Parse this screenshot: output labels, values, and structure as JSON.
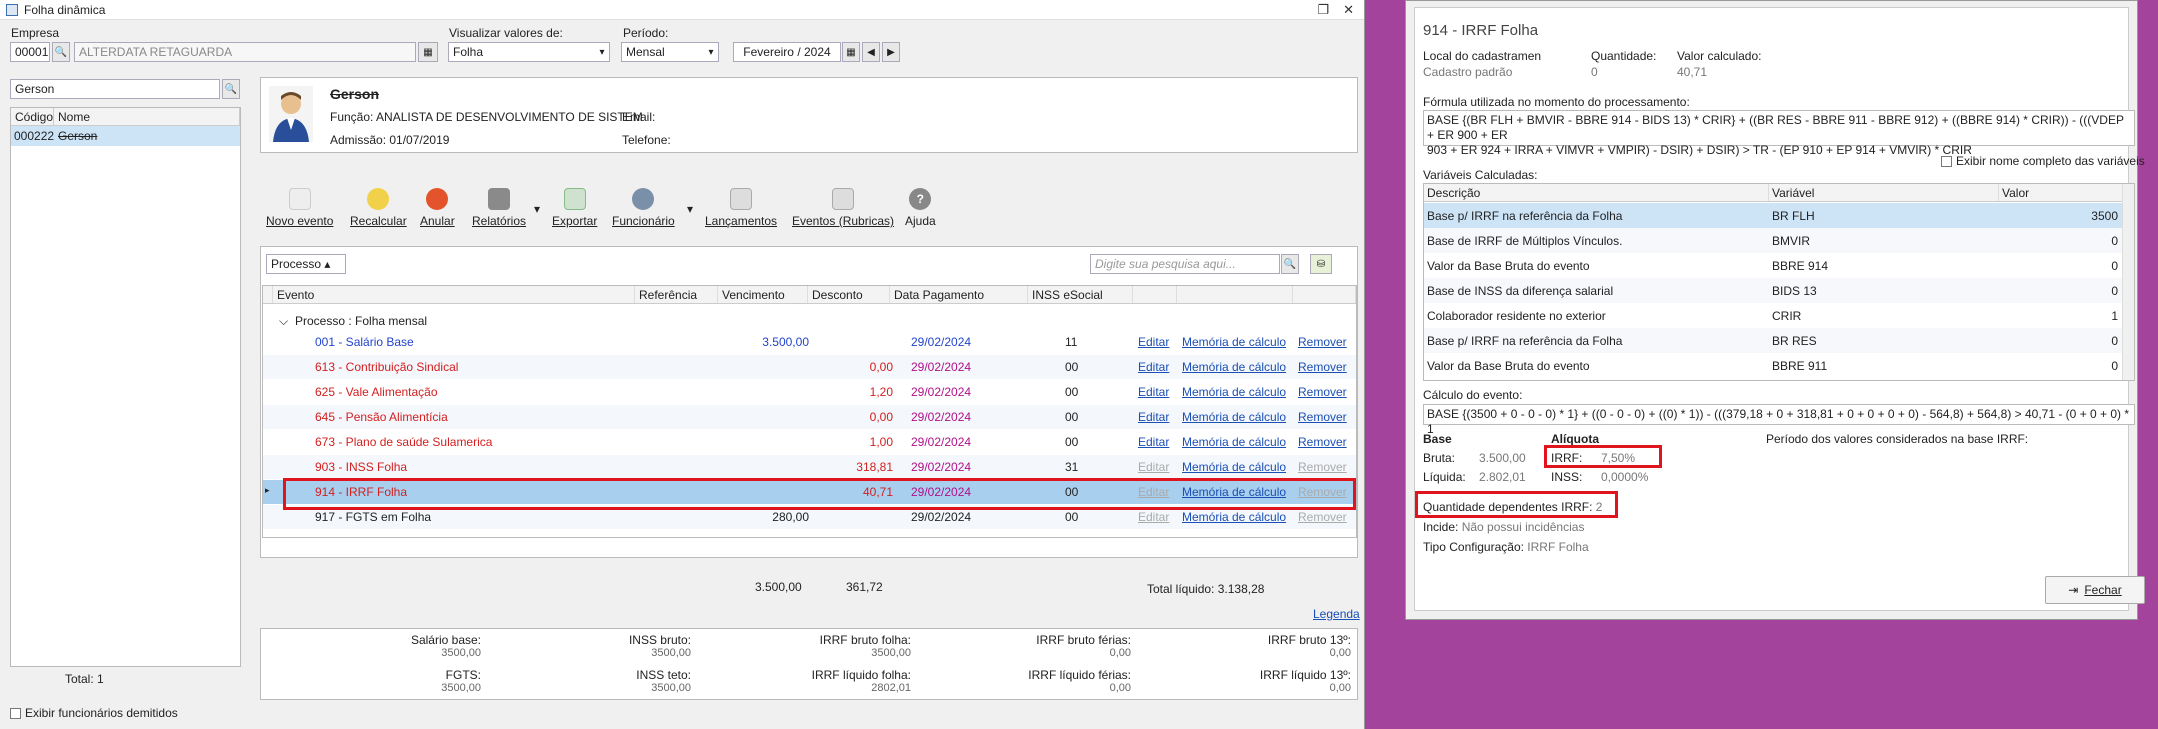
{
  "window": {
    "title": "Folha dinâmica"
  },
  "filters": {
    "empresa_label": "Empresa",
    "empresa_code": "00001",
    "empresa_name": "ALTERDATA RETAGUARDA",
    "visualizar_label": "Visualizar valores de:",
    "visualizar_value": "Folha",
    "periodo_label": "Período:",
    "periodo_value": "Mensal",
    "periodo_date": "Fevereiro / 2024"
  },
  "employee_search": {
    "value": "Gerson"
  },
  "employee_list": {
    "headers": [
      "Código",
      "Nome"
    ],
    "rows": [
      {
        "code": "000222",
        "name": "Gerson"
      }
    ],
    "total": "Total: 1",
    "show_dismissed": "Exibir funcionários demitidos"
  },
  "employee": {
    "name": "Gerson",
    "funcao": "Função: ANALISTA DE DESENVOLVIMENTO DE SISTEM",
    "admissao": "Admissão: 01/07/2019",
    "email": "Email:",
    "telefone": "Telefone:"
  },
  "toolbar": {
    "novo_evento": "Novo evento",
    "recalcular": "Recalcular",
    "anular": "Anular",
    "relatorios": "Relatórios",
    "exportar": "Exportar",
    "funcionario": "Funcionário",
    "lancamentos": "Lançamentos",
    "eventos": "Eventos (Rubricas)",
    "ajuda": "Ajuda"
  },
  "grid_filter": {
    "processo": "Processo",
    "search_placeholder": "Digite sua pesquisa aqui..."
  },
  "grid": {
    "headers": [
      "Evento",
      "Referência",
      "Vencimento",
      "Desconto",
      "Data Pagamento",
      "INSS eSocial"
    ],
    "group": "Processo : Folha mensal",
    "rows": [
      {
        "evento": "001 - Salário Base",
        "vencimento": "3.500,00",
        "desconto": "",
        "data": "29/02/2024",
        "inss": "11",
        "editar": "Editar",
        "memoria": "Memória de cálculo",
        "remover": "Remover",
        "color": "blue"
      },
      {
        "evento": "613 - Contribuição Sindical",
        "vencimento": "",
        "desconto": "0,00",
        "data": "29/02/2024",
        "inss": "00",
        "editar": "Editar",
        "memoria": "Memória de cálculo",
        "remover": "Remover",
        "color": "red"
      },
      {
        "evento": "625 - Vale Alimentação",
        "vencimento": "",
        "desconto": "1,20",
        "data": "29/02/2024",
        "inss": "00",
        "editar": "Editar",
        "memoria": "Memória de cálculo",
        "remover": "Remover",
        "color": "red"
      },
      {
        "evento": "645 - Pensão Alimentícia",
        "vencimento": "",
        "desconto": "0,00",
        "data": "29/02/2024",
        "inss": "00",
        "editar": "Editar",
        "memoria": "Memória de cálculo",
        "remover": "Remover",
        "color": "red"
      },
      {
        "evento": "673 - Plano de saúde Sulamerica",
        "vencimento": "",
        "desconto": "1,00",
        "data": "29/02/2024",
        "inss": "00",
        "editar": "Editar",
        "memoria": "Memória de cálculo",
        "remover": "Remover",
        "color": "red"
      },
      {
        "evento": "903 - INSS Folha",
        "vencimento": "",
        "desconto": "318,81",
        "data": "29/02/2024",
        "inss": "31",
        "editar": "Editar",
        "memoria": "Memória de cálculo",
        "remover": "Remover",
        "color": "red"
      },
      {
        "evento": "914 - IRRF Folha",
        "vencimento": "",
        "desconto": "40,71",
        "data": "29/02/2024",
        "inss": "00",
        "editar": "Editar",
        "memoria": "Memória de cálculo",
        "remover": "Remover",
        "color": "red"
      },
      {
        "evento": "917 - FGTS em Folha",
        "vencimento": "280,00",
        "desconto": "",
        "data": "29/02/2024",
        "inss": "00",
        "editar": "Editar",
        "memoria": "Memória de cálculo",
        "remover": "Remover",
        "color": "black"
      }
    ],
    "total_vencimento": "3.500,00",
    "total_desconto": "361,72",
    "total_liquido": "Total líquido: 3.138,28",
    "legenda": "Legenda"
  },
  "summary": {
    "salario_base": {
      "label": "Salário base:",
      "value": "3500,00"
    },
    "inss_bruto": {
      "label": "INSS bruto:",
      "value": "3500,00"
    },
    "irrf_bruto_folha": {
      "label": "IRRF bruto folha:",
      "value": "3500,00"
    },
    "irrf_bruto_ferias": {
      "label": "IRRF bruto férias:",
      "value": "0,00"
    },
    "irrf_bruto_13": {
      "label": "IRRF bruto 13º:",
      "value": "0,00"
    },
    "fgts": {
      "label": "FGTS:",
      "value": "3500,00"
    },
    "inss_teto": {
      "label": "INSS teto:",
      "value": "3500,00"
    },
    "irrf_liquido_folha": {
      "label": "IRRF líquido folha:",
      "value": "2802,01"
    },
    "irrf_liquido_ferias": {
      "label": "IRRF líquido férias:",
      "value": "0,00"
    },
    "irrf_liquido_13": {
      "label": "IRRF líquido 13º:",
      "value": "0,00"
    }
  },
  "dialog": {
    "title": "914 - IRRF Folha",
    "local_label": "Local do cadastramen",
    "local_value": "Cadastro padrão",
    "quantidade_label": "Quantidade:",
    "quantidade_value": "0",
    "valor_label": "Valor calculado:",
    "valor_value": "40,71",
    "formula_label": "Fórmula utilizada no momento do processamento:",
    "formula_line1": "BASE {(BR FLH + BMVIR - BBRE 914 - BIDS 13) * CRIR} + ((BR RES - BBRE 911 - BBRE 912) + ((BBRE 914) * CRIR)) - (((VDEP + ER 900 + ER",
    "formula_line2": "903 + ER 924 + IRRA + VIMVR + VMPIR) - DSIR) + DSIR) > TR - (EP 910 + EP 914 + VMVIR) * CRIR",
    "show_full_names": "Exibir nome completo das variáveis",
    "variaveis_label": "Variáveis Calculadas:",
    "var_headers": [
      "Descrição",
      "Variável",
      "Valor"
    ],
    "variables": [
      {
        "descricao": "Base p/ IRRF na referência da Folha",
        "variavel": "BR FLH",
        "valor": "3500"
      },
      {
        "descricao": "Base de IRRF de Múltiplos Vínculos.",
        "variavel": "BMVIR",
        "valor": "0"
      },
      {
        "descricao": "Valor da Base Bruta do evento",
        "variavel": "BBRE 914",
        "valor": "0"
      },
      {
        "descricao": "Base de INSS da diferença salarial",
        "variavel": "BIDS 13",
        "valor": "0"
      },
      {
        "descricao": "Colaborador residente no exterior",
        "variavel": "CRIR",
        "valor": "1"
      },
      {
        "descricao": "Base p/ IRRF na referência da Folha",
        "variavel": "BR RES",
        "valor": "0"
      },
      {
        "descricao": "Valor da Base Bruta do evento",
        "variavel": "BBRE 911",
        "valor": "0"
      }
    ],
    "calculo_label": "Cálculo do evento:",
    "calculo_value": "BASE {(3500 + 0 - 0 - 0) * 1} + ((0 - 0 - 0) + ((0) * 1)) - (((379,18 + 0 + 318,81 + 0 + 0 + 0 + 0) - 564,8) + 564,8) > 40,71 - (0 + 0 + 0) * 1",
    "base_label": "Base",
    "bruta_label": "Bruta:",
    "bruta_value": "3.500,00",
    "liquida_label": "Líquida:",
    "liquida_value": "2.802,01",
    "aliquota_label": "Alíquota",
    "irrf_label": "IRRF:",
    "irrf_value": "7,50%",
    "inss_label": "INSS:",
    "inss_value": "0,0000%",
    "periodo_label": "Período dos valores considerados na base IRRF:",
    "dependentes_label": "Quantidade dependentes IRRF:",
    "dependentes_value": "2",
    "incide_label": "Incide:",
    "incide_value": "Não possui incidências",
    "tipo_label": "Tipo Configuração:",
    "tipo_value": "IRRF Folha",
    "fechar": "Fechar"
  }
}
